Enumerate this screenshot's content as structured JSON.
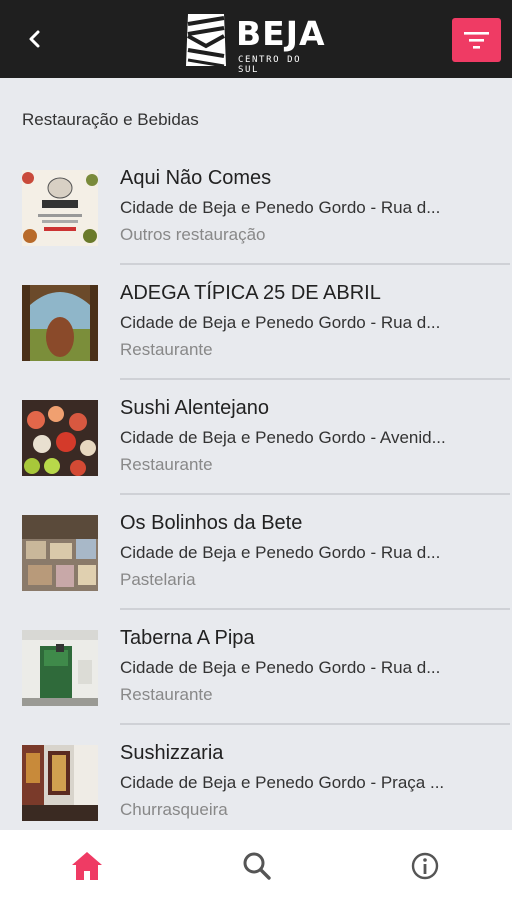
{
  "app": {
    "logo_title": "BEJA",
    "logo_subtitle": "CENTRO DO SUL",
    "accent_color": "#ef3b64",
    "header_color": "#1f1f1f"
  },
  "section": {
    "title": "Restauração e Bebidas"
  },
  "items": [
    {
      "name": "Aqui Não Comes",
      "address": "Cidade de Beja e Penedo Gordo - Rua d...",
      "category": "Outros restauração",
      "thumb_icon": "poster-thumbnail"
    },
    {
      "name": "ADEGA TÍPICA 25 DE ABRIL",
      "address": "Cidade de Beja e Penedo Gordo - Rua d...",
      "category": "Restaurante",
      "thumb_icon": "wine-cellar-thumbnail"
    },
    {
      "name": "Sushi Alentejano",
      "address": "Cidade de Beja e Penedo Gordo - Avenid...",
      "category": "Restaurante",
      "thumb_icon": "sushi-thumbnail"
    },
    {
      "name": "Os Bolinhos da Bete",
      "address": "Cidade de Beja e Penedo Gordo - Rua d...",
      "category": "Pastelaria",
      "thumb_icon": "pastry-thumbnail"
    },
    {
      "name": "Taberna A Pipa",
      "address": "Cidade de Beja e Penedo Gordo - Rua d...",
      "category": "Restaurante",
      "thumb_icon": "tavern-door-thumbnail"
    },
    {
      "name": "Sushizzaria",
      "address": "Cidade de Beja e Penedo Gordo - Praça ...",
      "category": "Churrasqueira",
      "thumb_icon": "restaurant-interior-thumbnail"
    }
  ],
  "bottom_nav": {
    "home_icon": "home-icon",
    "search_icon": "search-icon",
    "info_icon": "info-icon"
  }
}
